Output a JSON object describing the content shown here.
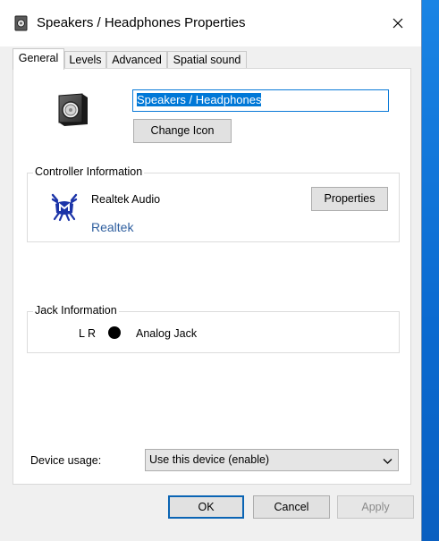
{
  "window": {
    "title": "Speakers / Headphones Properties",
    "title_icon": "speaker-icon",
    "close_icon": "close-icon"
  },
  "tabs": [
    {
      "label": "General",
      "active": true
    },
    {
      "label": "Levels",
      "active": false
    },
    {
      "label": "Advanced",
      "active": false
    },
    {
      "label": "Spatial sound",
      "active": false
    }
  ],
  "device": {
    "icon": "speaker-icon",
    "name_value": "Speakers / Headphones",
    "change_icon_label": "Change Icon"
  },
  "controller": {
    "group_title": "Controller Information",
    "icon": "realtek-crab-icon",
    "name": "Realtek Audio",
    "vendor": "Realtek",
    "properties_label": "Properties"
  },
  "jack": {
    "group_title": "Jack Information",
    "channels": "L R",
    "color_dot": "#000000",
    "label": "Analog Jack"
  },
  "usage": {
    "label": "Device usage:",
    "selected": "Use this device (enable)",
    "chevron_icon": "chevron-down-icon"
  },
  "buttons": {
    "ok": "OK",
    "cancel": "Cancel",
    "apply": "Apply"
  },
  "colors": {
    "accent": "#0078d7",
    "desktop": "#0a6fcf",
    "vendor_link": "#2f5f9f"
  }
}
